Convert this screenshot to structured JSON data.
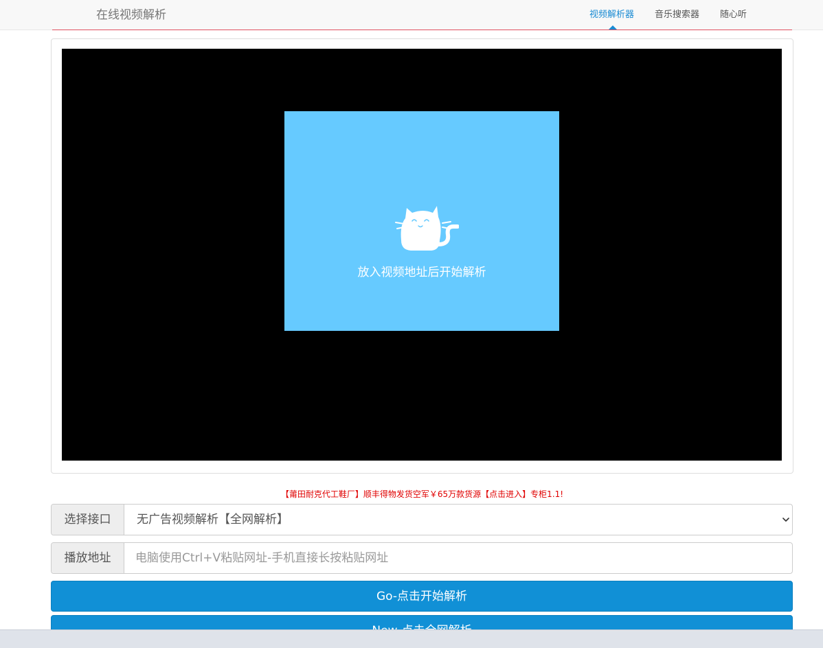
{
  "header": {
    "brand": "在线视频解析",
    "nav": [
      {
        "label": "视频解析器",
        "active": true
      },
      {
        "label": "音乐搜索器",
        "active": false
      },
      {
        "label": "随心听",
        "active": false
      }
    ]
  },
  "player": {
    "placeholder_text": "放入视频地址后开始解析"
  },
  "promo_text": "【莆田耐克代工鞋厂】顺丰得物发货空军￥65万款货源【点击进入】专柜1.1!",
  "interface_select": {
    "label": "选择接口",
    "selected": "无广告视频解析【全网解析】"
  },
  "url_input": {
    "label": "播放地址",
    "value": "",
    "placeholder": "电脑使用Ctrl+V粘贴网址-手机直接长按粘贴网址"
  },
  "buttons": {
    "go": "Go-点击开始解析",
    "new": "New-点击全网解析"
  },
  "colors": {
    "accent": "#1190d6",
    "placeholder_bg": "#66caff",
    "promo": "#e00000"
  },
  "icons": {
    "cat": "cat-icon",
    "dropdown": "chevron-down-icon"
  }
}
